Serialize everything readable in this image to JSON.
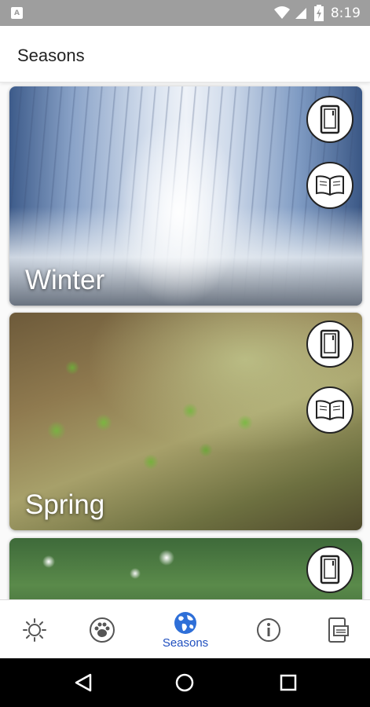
{
  "status_bar": {
    "time": "8:19",
    "app_indicator": "A",
    "icons": [
      "wifi-icon",
      "signal-icon",
      "battery-icon"
    ]
  },
  "app_bar": {
    "title": "Seasons"
  },
  "cards": [
    {
      "label": "Winter",
      "buttons": [
        "tablet-icon",
        "book-icon"
      ]
    },
    {
      "label": "Spring",
      "buttons": [
        "tablet-icon",
        "book-icon"
      ]
    },
    {
      "label": "",
      "buttons": [
        "tablet-icon"
      ]
    }
  ],
  "bottom_nav": {
    "items": [
      {
        "icon": "sun-icon",
        "label": ""
      },
      {
        "icon": "paw-icon",
        "label": ""
      },
      {
        "icon": "globe-icon",
        "label": "Seasons",
        "active": true
      },
      {
        "icon": "info-icon",
        "label": ""
      },
      {
        "icon": "devices-icon",
        "label": ""
      }
    ],
    "active_color": "#1f4fbf",
    "inactive_color": "#666666"
  },
  "system_nav": [
    "back-icon",
    "home-icon",
    "recents-icon"
  ]
}
